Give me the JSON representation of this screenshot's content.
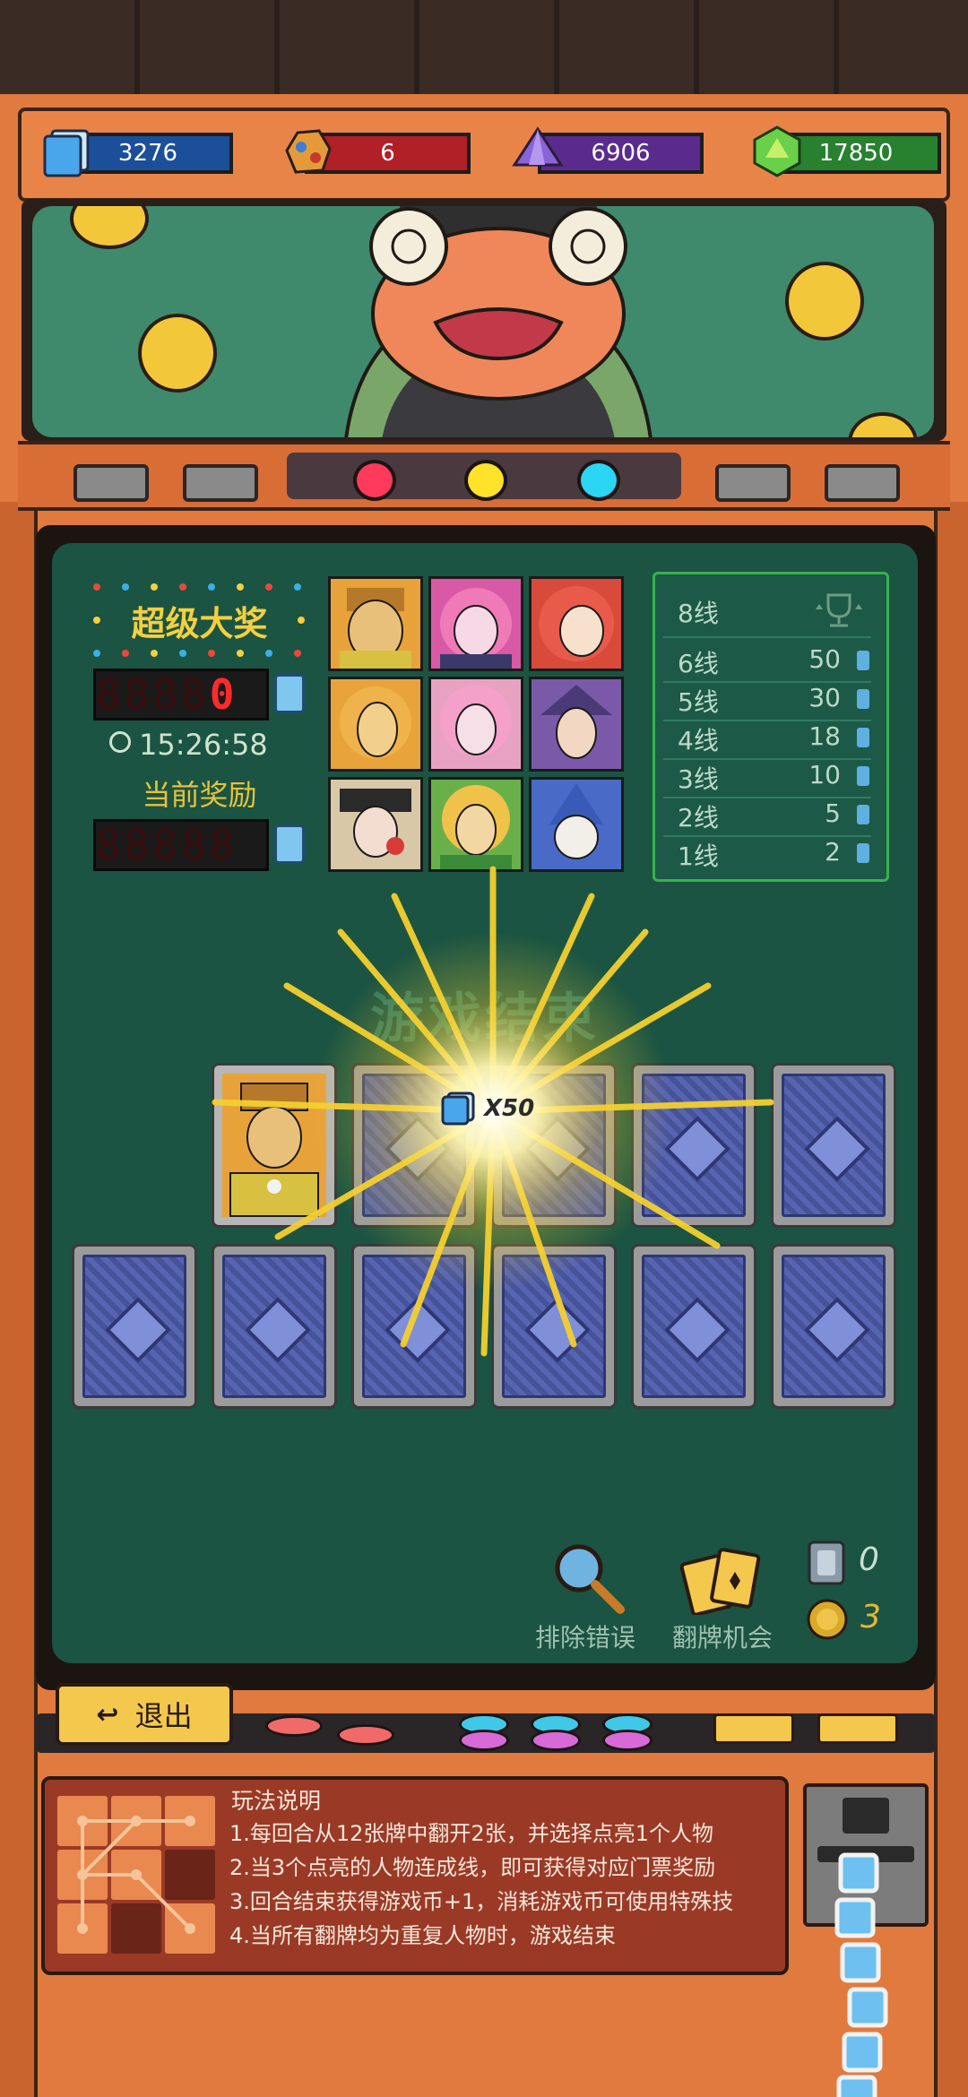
{
  "resources": [
    {
      "name": "tickets",
      "value": "3276",
      "color": "#1c4f9a",
      "icon": "ticket-icon"
    },
    {
      "name": "gem-rock",
      "value": "6",
      "color": "#b11f27",
      "icon": "ore-icon"
    },
    {
      "name": "crystal",
      "value": "6906",
      "color": "#5a2b8c",
      "icon": "purple-crystal-icon"
    },
    {
      "name": "emerald",
      "value": "17850",
      "color": "#27812f",
      "icon": "green-gem-icon"
    }
  ],
  "jackpot": {
    "title": "超级大奖",
    "led_value": "8888",
    "led_lit": "0",
    "timer": "15:26:58",
    "current_label": "当前奖励",
    "current_led": "88888"
  },
  "paytable": [
    {
      "label": "8线",
      "value": "",
      "icon": "trophy-icon"
    },
    {
      "label": "6线",
      "value": "50"
    },
    {
      "label": "5线",
      "value": "30"
    },
    {
      "label": "4线",
      "value": "18"
    },
    {
      "label": "3线",
      "value": "10"
    },
    {
      "label": "2线",
      "value": "5"
    },
    {
      "label": "1线",
      "value": "2"
    }
  ],
  "game_over": "游戏结束",
  "reward": "X50",
  "tools": {
    "remove_error": "排除错误",
    "flip_chance": "翻牌机会",
    "ticket_count": "0",
    "coin_count": "3"
  },
  "exit_label": "退出",
  "instructions": {
    "title": "玩法说明",
    "lines": [
      "1.每回合从12张牌中翻开2张，并选择点亮1个人物",
      "2.当3个点亮的人物连成线，即可获得对应门票奖励",
      "3.回合结束获得游戏币+1，消耗游戏币可使用特殊技",
      "4.当所有翻牌均为重复人物时，游戏结束"
    ]
  }
}
